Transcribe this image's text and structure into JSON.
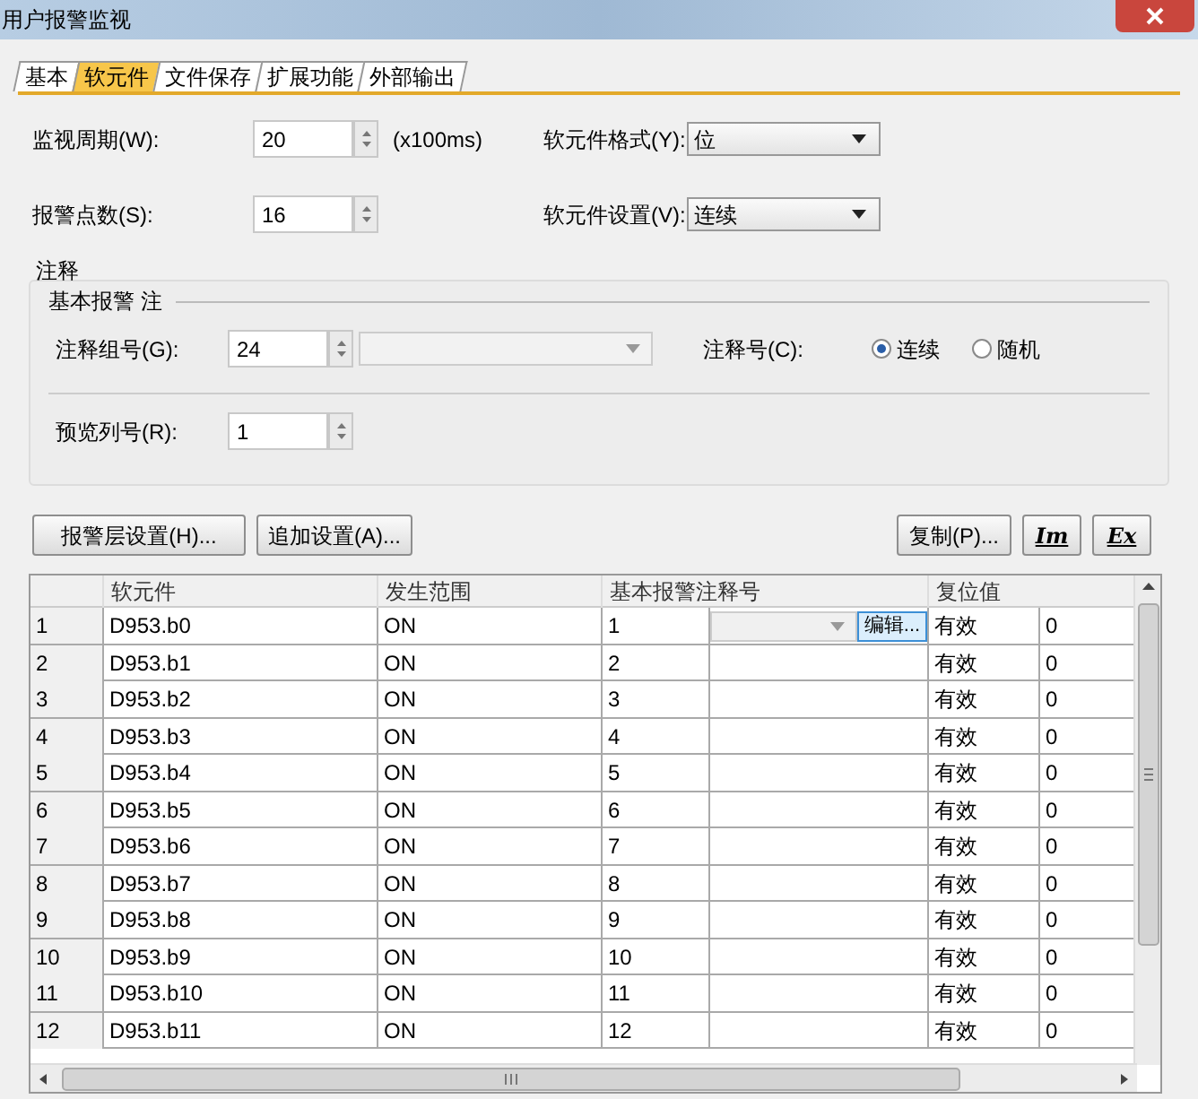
{
  "window": {
    "title": "用户报警监视"
  },
  "tabs": [
    {
      "label": "基本",
      "selected": false
    },
    {
      "label": "软元件",
      "selected": true
    },
    {
      "label": "文件保存",
      "selected": false
    },
    {
      "label": "扩展功能",
      "selected": false
    },
    {
      "label": "外部输出",
      "selected": false
    }
  ],
  "monitor_period": {
    "label": "监视周期(W):",
    "value": "20",
    "unit": "(x100ms)"
  },
  "device_format": {
    "label": "软元件格式(Y):",
    "value": "位"
  },
  "alarm_points": {
    "label": "报警点数(S):",
    "value": "16"
  },
  "device_setting": {
    "label": "软元件设置(V):",
    "value": "连续"
  },
  "comment_group": {
    "title": "注释",
    "subtitle": "基本报警 注",
    "group_no": {
      "label": "注释组号(G):",
      "value": "24"
    },
    "comment_no": {
      "label": "注释号(C):",
      "options": [
        {
          "label": "连续",
          "selected": true
        },
        {
          "label": "随机",
          "selected": false
        }
      ]
    },
    "preview_column": {
      "label": "预览列号(R):",
      "value": "1"
    }
  },
  "buttons": [
    {
      "label": "报警层设置(H)..."
    },
    {
      "label": "追加设置(A)..."
    },
    {
      "label": "复制(P)..."
    }
  ],
  "icon_buttons": [
    {
      "text": "Im"
    },
    {
      "text": "Ex"
    }
  ],
  "table": {
    "columns": [
      "软元件",
      "发生范围",
      "基本报警注释号",
      "复位值"
    ],
    "edit_button": "编辑...",
    "rows": [
      {
        "index": "1",
        "device": "D953.b0",
        "range": "ON",
        "comment": "1",
        "reset": "有效",
        "value": "0"
      },
      {
        "index": "2",
        "device": "D953.b1",
        "range": "ON",
        "comment": "2",
        "reset": "有效",
        "value": "0"
      },
      {
        "index": "3",
        "device": "D953.b2",
        "range": "ON",
        "comment": "3",
        "reset": "有效",
        "value": "0"
      },
      {
        "index": "4",
        "device": "D953.b3",
        "range": "ON",
        "comment": "4",
        "reset": "有效",
        "value": "0"
      },
      {
        "index": "5",
        "device": "D953.b4",
        "range": "ON",
        "comment": "5",
        "reset": "有效",
        "value": "0"
      },
      {
        "index": "6",
        "device": "D953.b5",
        "range": "ON",
        "comment": "6",
        "reset": "有效",
        "value": "0"
      },
      {
        "index": "7",
        "device": "D953.b6",
        "range": "ON",
        "comment": "7",
        "reset": "有效",
        "value": "0"
      },
      {
        "index": "8",
        "device": "D953.b7",
        "range": "ON",
        "comment": "8",
        "reset": "有效",
        "value": "0"
      },
      {
        "index": "9",
        "device": "D953.b8",
        "range": "ON",
        "comment": "9",
        "reset": "有效",
        "value": "0"
      },
      {
        "index": "10",
        "device": "D953.b9",
        "range": "ON",
        "comment": "10",
        "reset": "有效",
        "value": "0"
      },
      {
        "index": "11",
        "device": "D953.b10",
        "range": "ON",
        "comment": "11",
        "reset": "有效",
        "value": "0"
      },
      {
        "index": "12",
        "device": "D953.b11",
        "range": "ON",
        "comment": "12",
        "reset": "有效",
        "value": "0"
      }
    ]
  }
}
